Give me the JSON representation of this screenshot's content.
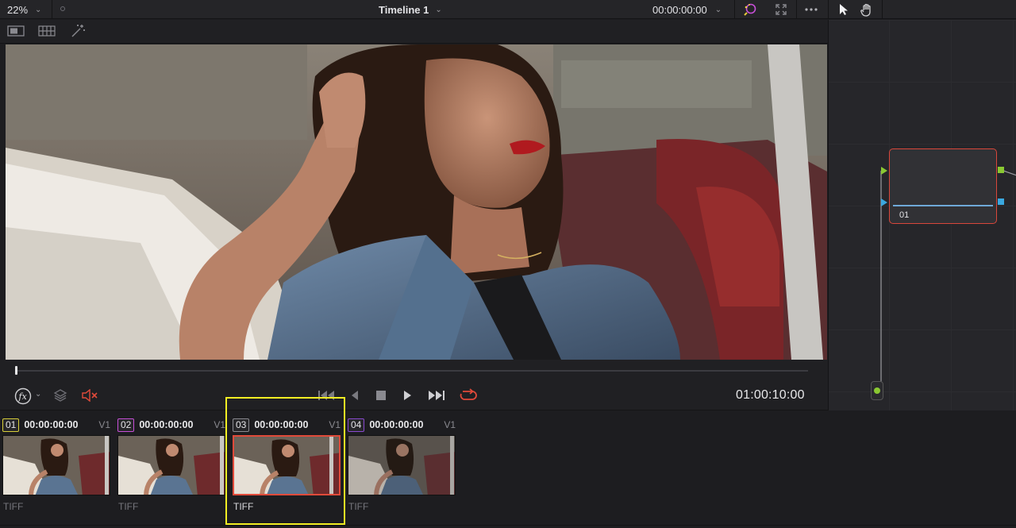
{
  "topbar": {
    "zoom": "22%",
    "timeline_title": "Timeline 1",
    "timecode": "00:00:00:00"
  },
  "transport": {
    "timecode": "01:00:10:00"
  },
  "node": {
    "label": "01"
  },
  "clips": [
    {
      "num": "01",
      "timecode": "00:00:00:00",
      "track": "V1",
      "format": "TIFF",
      "num_color": "#d8cf3a",
      "selected": false
    },
    {
      "num": "02",
      "timecode": "00:00:00:00",
      "track": "V1",
      "format": "TIFF",
      "num_color": "#c84fd8",
      "selected": false
    },
    {
      "num": "03",
      "timecode": "00:00:00:00",
      "track": "V1",
      "format": "TIFF",
      "num_color": "#8a8a90",
      "selected": true
    },
    {
      "num": "04",
      "timecode": "00:00:00:00",
      "track": "V1",
      "format": "TIFF",
      "num_color": "#8a4ad0",
      "selected": false
    }
  ],
  "colors": {
    "accent_red": "#e04a3a",
    "highlight_yellow": "#f1ee23",
    "node_input_green": "#8ac832",
    "node_output_blue": "#3aa8e0"
  },
  "icons": [
    "chevron-down-icon",
    "color-picker-icon",
    "fullscreen-icon",
    "more-options-icon",
    "pointer-icon",
    "hand-icon",
    "single-viewer-icon",
    "split-viewer-icon",
    "magic-wand-icon",
    "fx-icon",
    "layers-icon",
    "mute-icon",
    "skip-to-start-icon",
    "play-reverse-icon",
    "stop-icon",
    "play-icon",
    "skip-to-end-icon",
    "loop-icon"
  ]
}
